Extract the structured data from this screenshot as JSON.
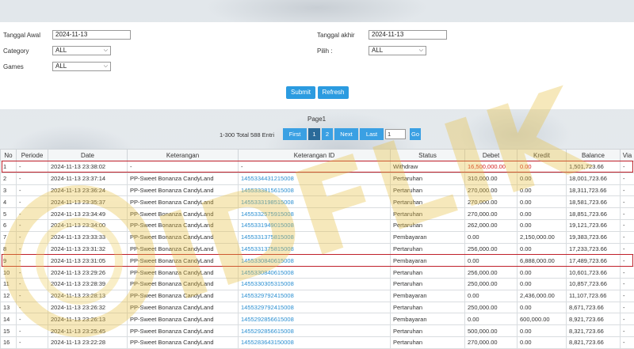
{
  "filters": {
    "tanggal_awal_label": "Tanggal Awal",
    "tanggal_awal_value": "2024-11-13",
    "tanggal_akhir_label": "Tanggal akhir",
    "tanggal_akhir_value": "2024-11-13",
    "category_label": "Category",
    "category_value": "ALL",
    "pilih_label": "Pilih :",
    "pilih_value": "ALL",
    "games_label": "Games",
    "games_value": "ALL",
    "submit_label": "Submit",
    "refresh_label": "Refresh"
  },
  "pager": {
    "title": "Page1",
    "total": "1-300 Total 588 Entri",
    "first": "First",
    "page1": "1",
    "page2": "2",
    "next": "Next",
    "last": "Last",
    "goto_value": "1",
    "go": "Go"
  },
  "table": {
    "headers": [
      "No",
      "Periode",
      "Date",
      "Keterangan",
      "Keterangan ID",
      "Status",
      "Debet",
      "Kredit",
      "Balance",
      "Via"
    ],
    "rows": [
      {
        "no": "1",
        "periode": "-",
        "date": "2024-11-13 23:38:02",
        "ket": "-",
        "ket_id": "-",
        "status": "Withdraw",
        "debet": "16,500,000.00",
        "kredit": "0.00",
        "balance": "1,501,723.66",
        "via": "-"
      },
      {
        "no": "2",
        "periode": "-",
        "date": "2024-11-13 23:37:14",
        "ket": "PP-Sweet Bonanza CandyLand",
        "ket_id": "1455334431215008",
        "status": "Pertaruhan",
        "debet": "310,000.00",
        "kredit": "0.00",
        "balance": "18,001,723.66",
        "via": "-"
      },
      {
        "no": "3",
        "periode": "-",
        "date": "2024-11-13 23:36:24",
        "ket": "PP-Sweet Bonanza CandyLand",
        "ket_id": "1455333815615008",
        "status": "Pertaruhan",
        "debet": "270,000.00",
        "kredit": "0.00",
        "balance": "18,311,723.66",
        "via": "-"
      },
      {
        "no": "4",
        "periode": "-",
        "date": "2024-11-13 23:35:37",
        "ket": "PP-Sweet Bonanza CandyLand",
        "ket_id": "1455333198515008",
        "status": "Pertaruhan",
        "debet": "270,000.00",
        "kredit": "0.00",
        "balance": "18,581,723.66",
        "via": "-"
      },
      {
        "no": "5",
        "periode": "-",
        "date": "2024-11-13 23:34:49",
        "ket": "PP-Sweet Bonanza CandyLand",
        "ket_id": "1455332575915008",
        "status": "Pertaruhan",
        "debet": "270,000.00",
        "kredit": "0.00",
        "balance": "18,851,723.66",
        "via": "-"
      },
      {
        "no": "6",
        "periode": "-",
        "date": "2024-11-13 23:34:00",
        "ket": "PP-Sweet Bonanza CandyLand",
        "ket_id": "1455331949015008",
        "status": "Pertaruhan",
        "debet": "262,000.00",
        "kredit": "0.00",
        "balance": "19,121,723.66",
        "via": "-"
      },
      {
        "no": "7",
        "periode": "-",
        "date": "2024-11-13 23:33:33",
        "ket": "PP-Sweet Bonanza CandyLand",
        "ket_id": "1455331375815008",
        "status": "Pembayaran",
        "debet": "0.00",
        "kredit": "2,150,000.00",
        "balance": "19,383,723.66",
        "via": "-"
      },
      {
        "no": "8",
        "periode": "-",
        "date": "2024-11-13 23:31:32",
        "ket": "PP-Sweet Bonanza CandyLand",
        "ket_id": "1455331375815008",
        "status": "Pertaruhan",
        "debet": "256,000.00",
        "kredit": "0.00",
        "balance": "17,233,723.66",
        "via": "-"
      },
      {
        "no": "9",
        "periode": "-",
        "date": "2024-11-13 23:31:05",
        "ket": "PP-Sweet Bonanza CandyLand",
        "ket_id": "1455330840615008",
        "status": "Pembayaran",
        "debet": "0.00",
        "kredit": "6,888,000.00",
        "balance": "17,489,723.66",
        "via": "-"
      },
      {
        "no": "10",
        "periode": "-",
        "date": "2024-11-13 23:29:26",
        "ket": "PP-Sweet Bonanza CandyLand",
        "ket_id": "1455330840615008",
        "status": "Pertaruhan",
        "debet": "256,000.00",
        "kredit": "0.00",
        "balance": "10,601,723.66",
        "via": "-"
      },
      {
        "no": "11",
        "periode": "-",
        "date": "2024-11-13 23:28:39",
        "ket": "PP-Sweet Bonanza CandyLand",
        "ket_id": "1455330305315008",
        "status": "Pertaruhan",
        "debet": "250,000.00",
        "kredit": "0.00",
        "balance": "10,857,723.66",
        "via": "-"
      },
      {
        "no": "12",
        "periode": "-",
        "date": "2024-11-13 23:28:13",
        "ket": "PP-Sweet Bonanza CandyLand",
        "ket_id": "1455329792415008",
        "status": "Pembayaran",
        "debet": "0.00",
        "kredit": "2,436,000.00",
        "balance": "11,107,723.66",
        "via": "-"
      },
      {
        "no": "13",
        "periode": "-",
        "date": "2024-11-13 23:26:32",
        "ket": "PP-Sweet Bonanza CandyLand",
        "ket_id": "1455329792415008",
        "status": "Pertaruhan",
        "debet": "250,000.00",
        "kredit": "0.00",
        "balance": "8,671,723.66",
        "via": "-"
      },
      {
        "no": "14",
        "periode": "-",
        "date": "2024-11-13 23:26:13",
        "ket": "PP-Sweet Bonanza CandyLand",
        "ket_id": "1455292856615008",
        "status": "Pembayaran",
        "debet": "0.00",
        "kredit": "600,000.00",
        "balance": "8,921,723.66",
        "via": "-"
      },
      {
        "no": "15",
        "periode": "-",
        "date": "2024-11-13 23:25:45",
        "ket": "PP-Sweet Bonanza CandyLand",
        "ket_id": "1455292856615008",
        "status": "Pertaruhan",
        "debet": "500,000.00",
        "kredit": "0.00",
        "balance": "8,321,723.66",
        "via": "-"
      },
      {
        "no": "16",
        "periode": "-",
        "date": "2024-11-13 23:22:28",
        "ket": "PP-Sweet Bonanza CandyLand",
        "ket_id": "1455283643150008",
        "status": "Pertaruhan",
        "debet": "270,000.00",
        "kredit": "0.00",
        "balance": "8,821,723.66",
        "via": "-"
      }
    ]
  },
  "watermark_text": "IDFLIK",
  "colors": {
    "button_blue": "#2b9be0",
    "pager_active": "#2a6a99",
    "link_blue": "#2b8fd1",
    "withdraw_red": "#d42020",
    "highlight_red": "#c0202a",
    "watermark_gold": "#e8c040"
  }
}
